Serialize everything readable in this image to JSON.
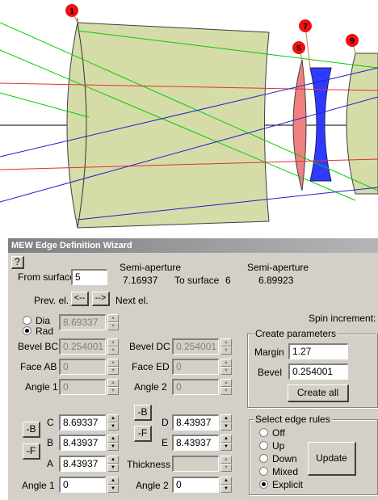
{
  "surface_markers": [
    "1",
    "5",
    "7",
    "9"
  ],
  "colors": {
    "lens_fill": "#d6dca8",
    "pink_lens": "#f08080",
    "blue_lens": "#2e3bff",
    "ray_green": "#00cc00",
    "ray_red": "#e03030",
    "ray_blue": "#2020cc",
    "dialog_face": "#d4d0c8"
  },
  "dialog": {
    "title": "MEW Edge Definition Wizard",
    "help_label": "?",
    "from_surface_label": "From surface",
    "from_surface_value": "5",
    "semi_aperture_label_1": "Semi-aperture",
    "semi_aperture_value_1": "7.16937",
    "to_surface_label": "To surface",
    "to_surface_value": "6",
    "semi_aperture_label_2": "Semi-aperture",
    "semi_aperture_value_2": "6.89923",
    "prev_el_label": "Prev. el.",
    "prev_button": "<--",
    "next_button": "-->",
    "next_el_label": "Next el.",
    "spin_increment_label": "Spin increment:",
    "dia_label": "Dia",
    "rad_label": "Rad",
    "dia_rad_value": "8.69337",
    "bevel_bc_label": "Bevel BC",
    "bevel_bc_value": "0.254001",
    "bevel_dc_label": "Bevel DC",
    "bevel_dc_value": "0.254001",
    "face_ab_label": "Face AB",
    "face_ab_value": "0",
    "face_ed_label": "Face ED",
    "face_ed_value": "0",
    "angle1_top_label": "Angle 1",
    "angle1_top_value": "0",
    "angle2_top_label": "Angle 2",
    "angle2_top_value": "0",
    "create_params": {
      "title": "Create parameters",
      "margin_label": "Margin",
      "margin_value": "1.27",
      "bevel_label": "Bevel",
      "bevel_value": "0.254001",
      "create_all_button": "Create all"
    },
    "minus_b_button": "-B",
    "minus_f_button": "-F",
    "c_label": "C",
    "c_value": "8.69337",
    "b_label": "B",
    "b_value": "8.43937",
    "a_label": "A",
    "a_value": "8.43937",
    "d_label": "D",
    "d_value": "8.43937",
    "e_label": "E",
    "e_value": "8.43937",
    "thickness_label": "Thickness",
    "thickness_value": "",
    "angle1_label": "Angle 1",
    "angle1_value": "0",
    "angle2_label": "Angle 2",
    "angle2_value": "0",
    "edge_rules": {
      "title": "Select edge rules",
      "options": [
        "Off",
        "Up",
        "Down",
        "Mixed",
        "Explicit"
      ],
      "selected": "Explicit",
      "update_button": "Update"
    }
  }
}
